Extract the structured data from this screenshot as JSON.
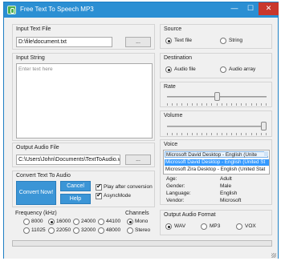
{
  "window": {
    "title": "Free Text To Speech MP3",
    "controls": {
      "minimize": "—",
      "maximize": "☐",
      "close": "✕"
    }
  },
  "input_text_file": {
    "label": "Input Text File",
    "path": "D:\\file\\document.txt",
    "browse": "..."
  },
  "input_string": {
    "label": "Input String",
    "placeholder": "Enter text here"
  },
  "output_audio_file": {
    "label": "Output Audio File",
    "path": "C:\\Users\\John\\Documents\\TextToAudio.wav",
    "browse": "..."
  },
  "convert": {
    "label": "Convert Text To Audio",
    "convert_now": "Convert Now!",
    "cancel": "Cancel",
    "help": "Help",
    "play_after_conversion": {
      "label": "Play after conversion",
      "checked": true
    },
    "async_mode": {
      "label": "AsyncMode",
      "checked": true
    }
  },
  "frequency": {
    "label": "Frequency (kHz)",
    "options": [
      "8000",
      "16000",
      "24000",
      "44100",
      "11025",
      "22050",
      "32000",
      "48000"
    ],
    "selected": "16000"
  },
  "channels": {
    "label": "Channels",
    "options": [
      "Mono",
      "Stereo"
    ],
    "selected": "Mono"
  },
  "source": {
    "label": "Source",
    "options": [
      "Text file",
      "String"
    ],
    "selected": "Text file"
  },
  "destination": {
    "label": "Destination",
    "options": [
      "Audio file",
      "Audio array"
    ],
    "selected": "Audio file"
  },
  "rate": {
    "label": "Rate",
    "value_fraction": 0.5
  },
  "volume": {
    "label": "Volume",
    "value_fraction": 1.0
  },
  "voice": {
    "label": "Voice",
    "selected_display": "Microsoft David Desktop - English (Unite",
    "items": [
      "Microsoft David Desktop - English (United St",
      "Microsoft Zira Desktop - English (United Stat"
    ],
    "details": [
      {
        "key": "Age:",
        "value": "Adult"
      },
      {
        "key": "Gender:",
        "value": "Male"
      },
      {
        "key": "Language:",
        "value": "English"
      },
      {
        "key": "Vendor:",
        "value": "Microsoft"
      }
    ]
  },
  "output_format": {
    "label": "Output Audio Format",
    "options": [
      "WAV",
      "MP3",
      "VOX"
    ],
    "selected": "WAV"
  },
  "progress": {
    "value_fraction": 0.0
  },
  "colors": {
    "titlebar": "#2b8fd3",
    "button_blue": "#3b95d6",
    "selection": "#3399ff"
  }
}
